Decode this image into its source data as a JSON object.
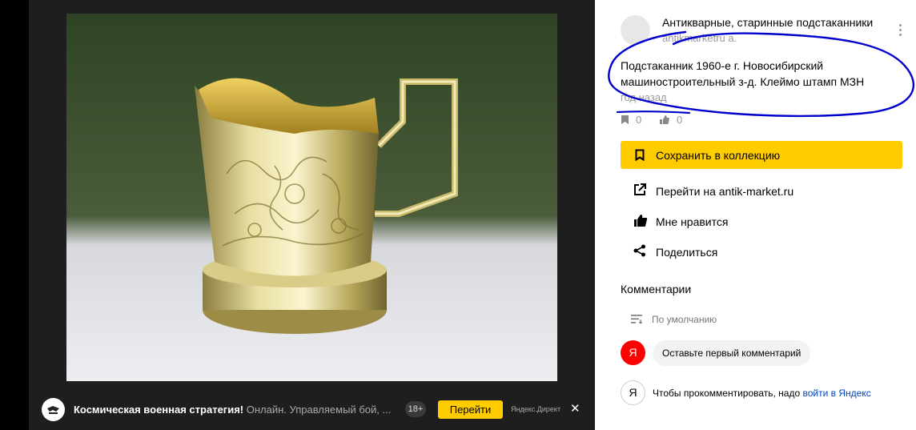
{
  "ad": {
    "title": "Космическая военная стратегия!",
    "subtitle": "Онлайн. Управляемый бой, ...",
    "age": "18+",
    "button": "Перейти",
    "source": "Яндекс.Директ",
    "close": "✕"
  },
  "card": {
    "author": "Антикварные, старинные подстаканники",
    "handle": "antikmarketru a.",
    "description": "Подстаканник 1960-е г. Новосибирский машиностроительный з-д. Клеймо штамп МЗН",
    "time": "год назад",
    "collections_count": "0",
    "likes_count": "0"
  },
  "actions": {
    "save": "Сохранить в коллекцию",
    "visit": "Перейти на antik-market.ru",
    "like": "Мне нравится",
    "share": "Поделиться"
  },
  "comments": {
    "title": "Комментарии",
    "sort": "По умолчанию",
    "avatar_letter": "Я",
    "first_prompt": "Оставьте первый комментарий",
    "login_text": "Чтобы прокомментировать, надо",
    "login_link": "войти в Яндекс"
  },
  "colors": {
    "accent": "#ffcc00",
    "link": "#0044bb",
    "pen": "#0000cc",
    "yandex_red": "#ff0000"
  },
  "icons": [
    "bookmark-icon",
    "like-icon",
    "external-link-icon",
    "thumb-up-icon",
    "share-icon",
    "sort-icon",
    "kebab-menu-icon",
    "close-icon"
  ]
}
